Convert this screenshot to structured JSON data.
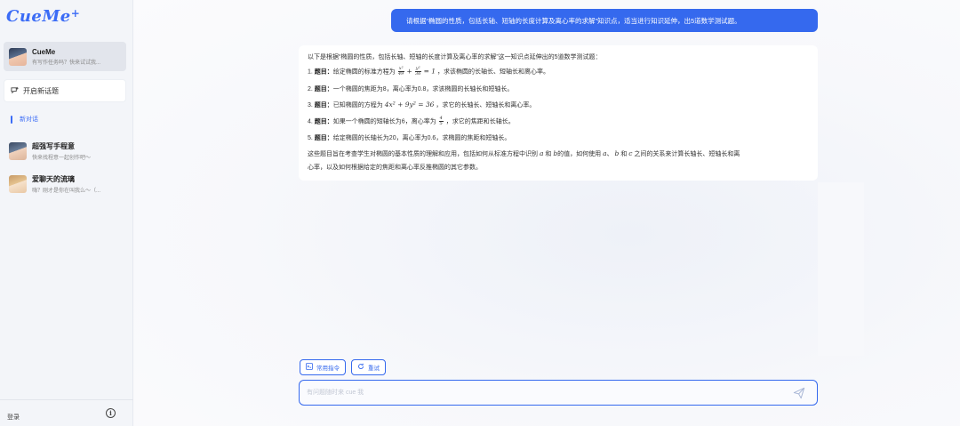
{
  "app": {
    "logo": "CueMe",
    "logo_star": "+"
  },
  "sidebar": {
    "bot": {
      "name": "CueMe",
      "subtitle": "有写作任务吗？快来试试我..."
    },
    "new_topic_label": "开启新话题",
    "new_chat_label": "新对话",
    "conversations": [
      {
        "title": "超强写手程意",
        "subtitle": "快来找程意一起创作吧～"
      },
      {
        "title": "爱聊天的流璃",
        "subtitle": "嗨？刚才是你在叫我么～（..."
      }
    ],
    "login_label": "登录",
    "info_icon": "ⓘ"
  },
  "chat": {
    "user_message": "请根据“椭圆的性质，包括长轴、短轴的长度计算及离心率的求解”知识点，适当进行知识延伸，出5道数学测试题。",
    "bot_intro": "以下是根据“椭圆的性质，包括长轴、短轴的长度计算及离心率的求解”这一知识点延伸出的5道数学测试题：",
    "questions": [
      {
        "num": "1.",
        "label": "题目：",
        "pre": "给定椭圆的标准方程为",
        "post": "，求该椭圆的长轴长、短轴长和离心率。"
      },
      {
        "num": "2.",
        "label": "题目：",
        "pre": "一个椭圆的焦距为8，离心率为0.8，求该椭圆的长轴长和短轴长。",
        "post": ""
      },
      {
        "num": "3.",
        "label": "题目：",
        "pre": "已知椭圆的方程为",
        "equation": "4x² + 9y² = 36",
        "post": "，求它的长轴长、短轴长和离心率。"
      },
      {
        "num": "4.",
        "label": "题目：",
        "pre": "如果一个椭圆的短轴长为6，离心率为",
        "post": "，求它的焦距和长轴长。"
      },
      {
        "num": "5.",
        "label": "题目：",
        "pre": "给定椭圆的长轴长为20，离心率为0.6，求椭圆的焦距和短轴长。",
        "post": ""
      }
    ],
    "q1_frac1": {
      "num": "x²",
      "den": "49"
    },
    "q1_frac2": {
      "num": "y²",
      "den": "36"
    },
    "q1_rhs": "= 1",
    "q4_frac": {
      "num": "4",
      "den": "5"
    },
    "summary_1": "这些题目旨在考查学生对椭圆的基本性质的理解和应用，包括如何从标准方程中识别",
    "summary_a": "a",
    "summary_and": "和",
    "summary_b": "b",
    "summary_2": "的值，如何使用",
    "summary_3": "、",
    "summary_4": "和",
    "summary_c": "c",
    "summary_5": "之间的关系来计算长轴长、短轴长和离",
    "summary_6": "心率，以及如何根据给定的焦距和离心率反推椭圆的其它参数。"
  },
  "actions": {
    "common_commands": "常用指令",
    "retry": "重试"
  },
  "input": {
    "placeholder": "有问题随时来 cue 我",
    "value": ""
  },
  "colors": {
    "accent": "#3569ee",
    "sidebar_bg": "#f3f5f9"
  }
}
